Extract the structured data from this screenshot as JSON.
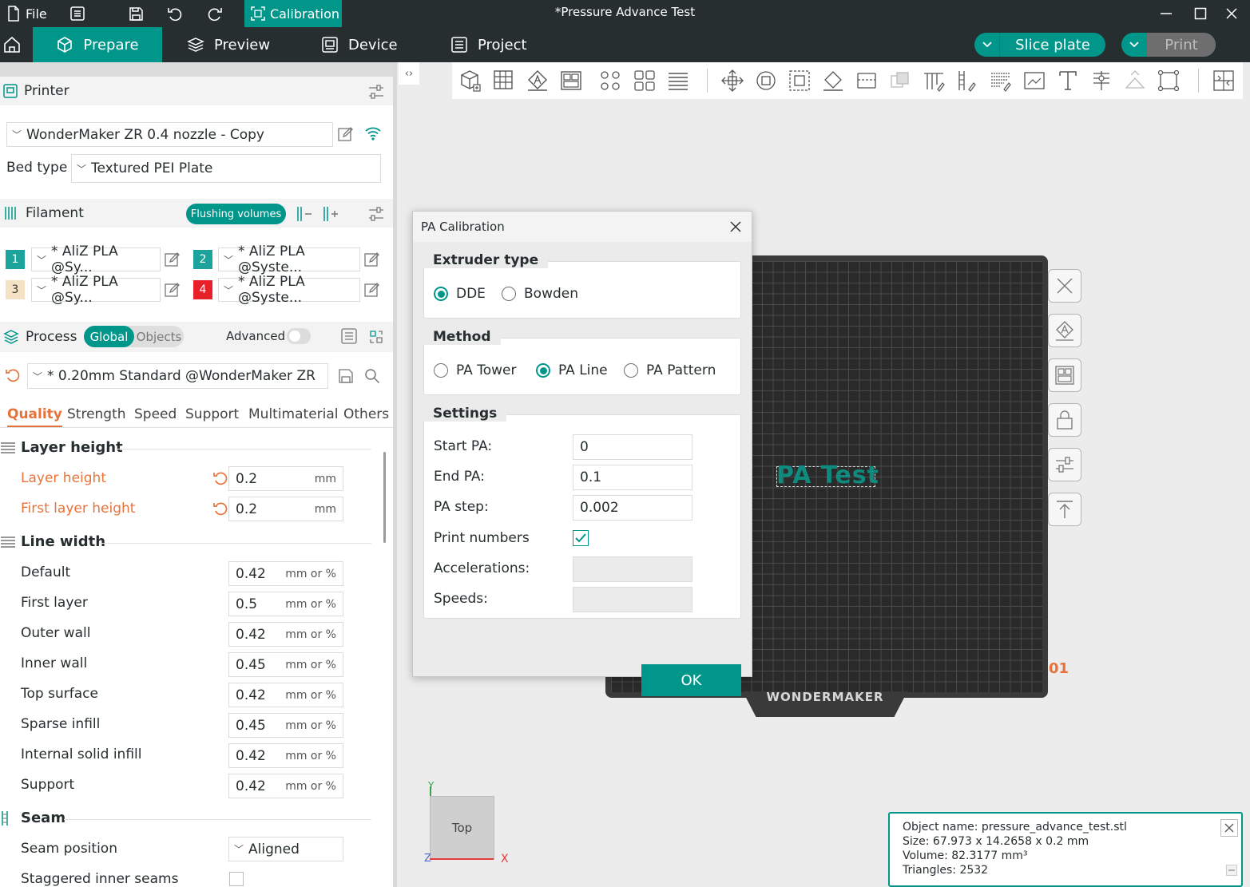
{
  "titlebar": {
    "file": "File",
    "calibration": "Calibration",
    "window_title": "*Pressure Advance Test"
  },
  "tabs": {
    "prepare": "Prepare",
    "preview": "Preview",
    "device": "Device",
    "project": "Project",
    "slice_plate": "Slice plate",
    "print": "Print"
  },
  "printer": {
    "section_title": "Printer",
    "preset": "WonderMaker ZR 0.4 nozzle - Copy",
    "bed_type_label": "Bed type",
    "bed_type": "Textured PEI Plate"
  },
  "filament": {
    "section_title": "Filament",
    "flushing_button": "Flushing volumes",
    "slots": [
      {
        "num": "1",
        "name": "* AliZ PLA @Sy...",
        "color": "#1ba39c"
      },
      {
        "num": "2",
        "name": "* AliZ PLA @Syste...",
        "color": "#1ba39c"
      },
      {
        "num": "3",
        "name": "* AliZ PLA @Sy...",
        "color": "#f5e2c4"
      },
      {
        "num": "4",
        "name": "* AliZ PLA @Syste...",
        "color": "#e8202a"
      }
    ]
  },
  "process": {
    "section_title": "Process",
    "global": "Global",
    "objects": "Objects",
    "advanced": "Advanced",
    "preset": "* 0.20mm Standard @WonderMaker ZR",
    "subtabs": [
      "Quality",
      "Strength",
      "Speed",
      "Support",
      "Multimaterial",
      "Others"
    ]
  },
  "quality": {
    "layer_height_group": "Layer height",
    "layer_height_label": "Layer height",
    "layer_height_value": "0.2",
    "first_layer_height_label": "First layer height",
    "first_layer_height_value": "0.2",
    "unit_mm": "mm",
    "line_width_group": "Line width",
    "unit_mm_pct": "mm or %",
    "line_widths": [
      {
        "label": "Default",
        "value": "0.42"
      },
      {
        "label": "First layer",
        "value": "0.5"
      },
      {
        "label": "Outer wall",
        "value": "0.42"
      },
      {
        "label": "Inner wall",
        "value": "0.45"
      },
      {
        "label": "Top surface",
        "value": "0.42"
      },
      {
        "label": "Sparse infill",
        "value": "0.45"
      },
      {
        "label": "Internal solid infill",
        "value": "0.42"
      },
      {
        "label": "Support",
        "value": "0.42"
      }
    ],
    "seam_group": "Seam",
    "seam_position_label": "Seam position",
    "seam_position_value": "Aligned",
    "staggered_label": "Staggered inner seams"
  },
  "dialog": {
    "title": "PA Calibration",
    "extruder_type": "Extruder type",
    "extruder_options": [
      "DDE",
      "Bowden"
    ],
    "method": "Method",
    "method_options": [
      "PA Tower",
      "PA Line",
      "PA Pattern"
    ],
    "settings": "Settings",
    "start_pa_label": "Start PA:",
    "start_pa": "0",
    "end_pa_label": "End PA:",
    "end_pa": "0.1",
    "pa_step_label": "PA step:",
    "pa_step": "0.002",
    "print_numbers_label": "Print numbers",
    "accelerations_label": "Accelerations:",
    "speeds_label": "Speeds:",
    "ok": "OK"
  },
  "canvas": {
    "bed_brand": "WONDERMAKER",
    "model_text": "PA Test",
    "plate_number": "01",
    "view_cube": "Top",
    "axis_x": "X",
    "axis_y": "Y",
    "axis_z": "Z"
  },
  "info": {
    "object_name": "Object name: pressure_advance_test.stl",
    "size": "Size: 67.973 x 14.2658 x 0.2 mm",
    "volume": "Volume: 82.3177 mm³",
    "triangles": "Triangles: 2532"
  },
  "colors": {
    "accent": "#00968a",
    "dark": "#262e30",
    "orange": "#e8733a"
  }
}
